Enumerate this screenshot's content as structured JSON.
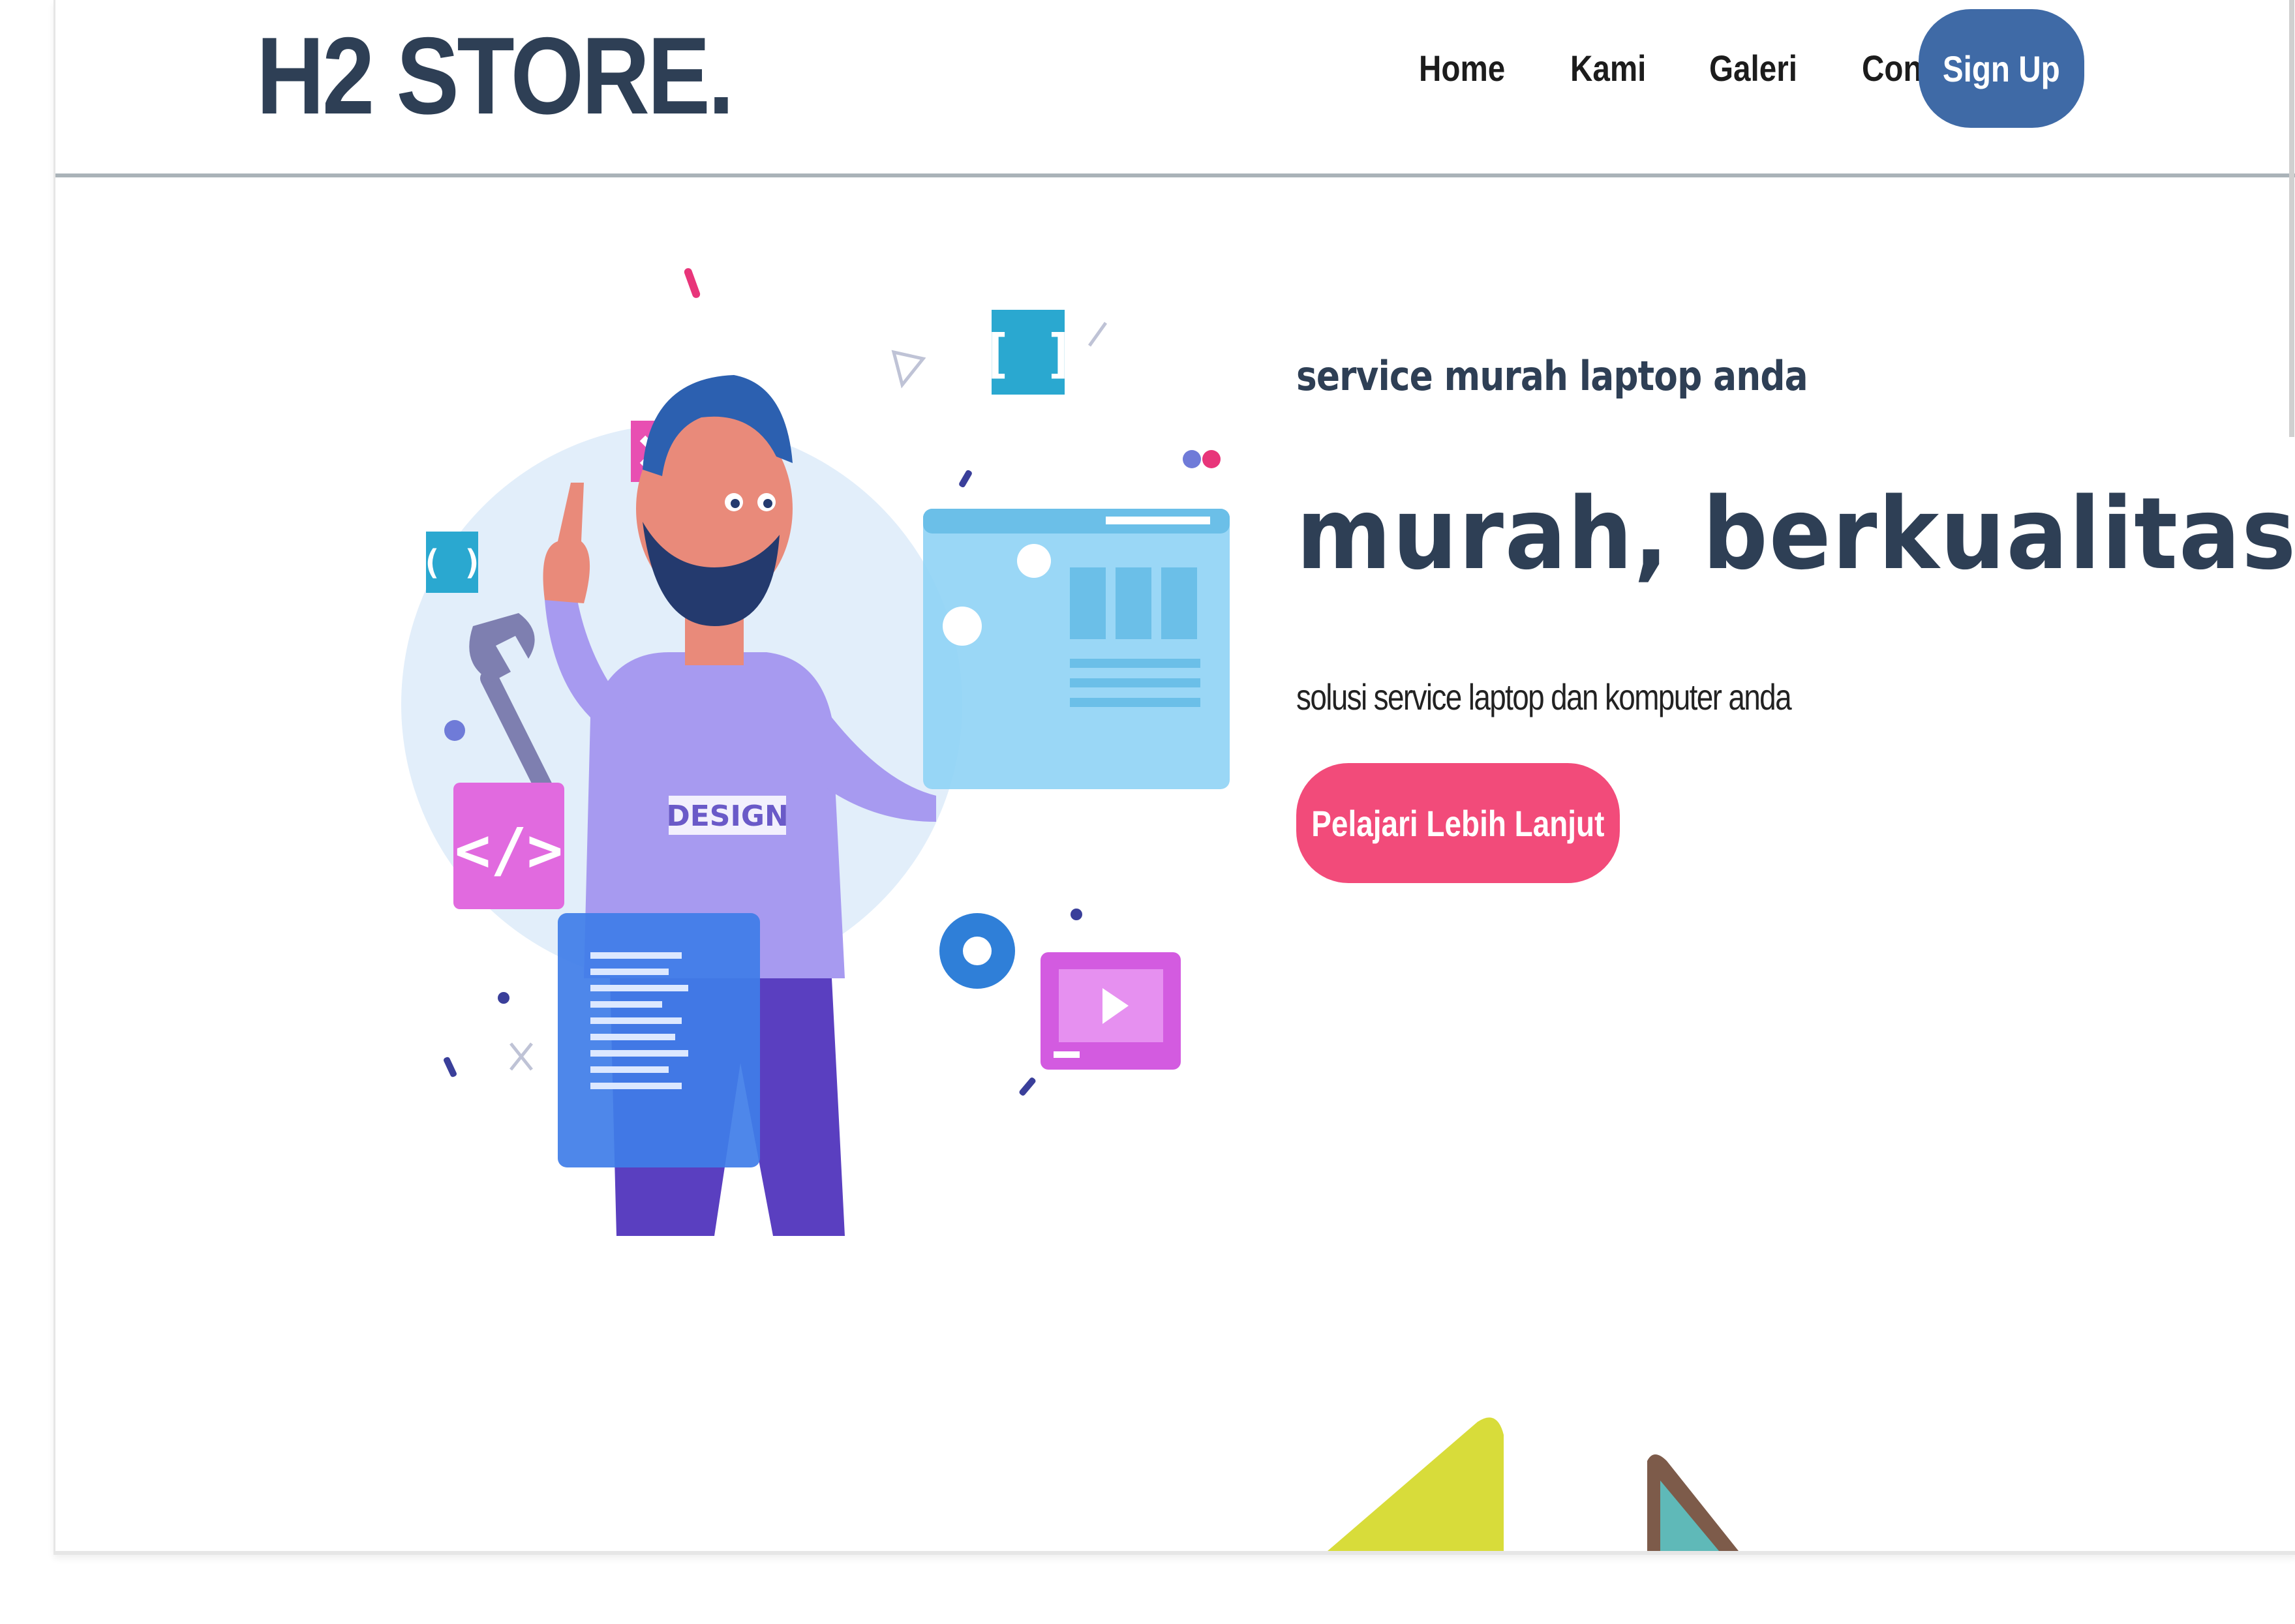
{
  "navbar": {
    "brand": "H2 STORE.",
    "links": [
      "Home",
      "Kami",
      "Galeri",
      "Contact"
    ],
    "signup_label": "Sign Up"
  },
  "hero": {
    "tagline": "service murah laptop anda",
    "headline": "murah, berkualitas",
    "subtext": "solusi service laptop dan komputer anda",
    "cta_label": "Pelajari Lebih Lanjut",
    "illustration_label": "DESIGN"
  },
  "colors": {
    "brand_text": "#2e3f55",
    "signup_bg": "#3f6aa6",
    "cta_bg": "#f24b7a",
    "divider": "#aab3b8"
  },
  "icons": {
    "illustration": "designer-illustration",
    "code": "code-icon",
    "play": "play-icon",
    "gear": "gear-icon",
    "wrench": "wrench-icon",
    "close": "close-icon"
  }
}
